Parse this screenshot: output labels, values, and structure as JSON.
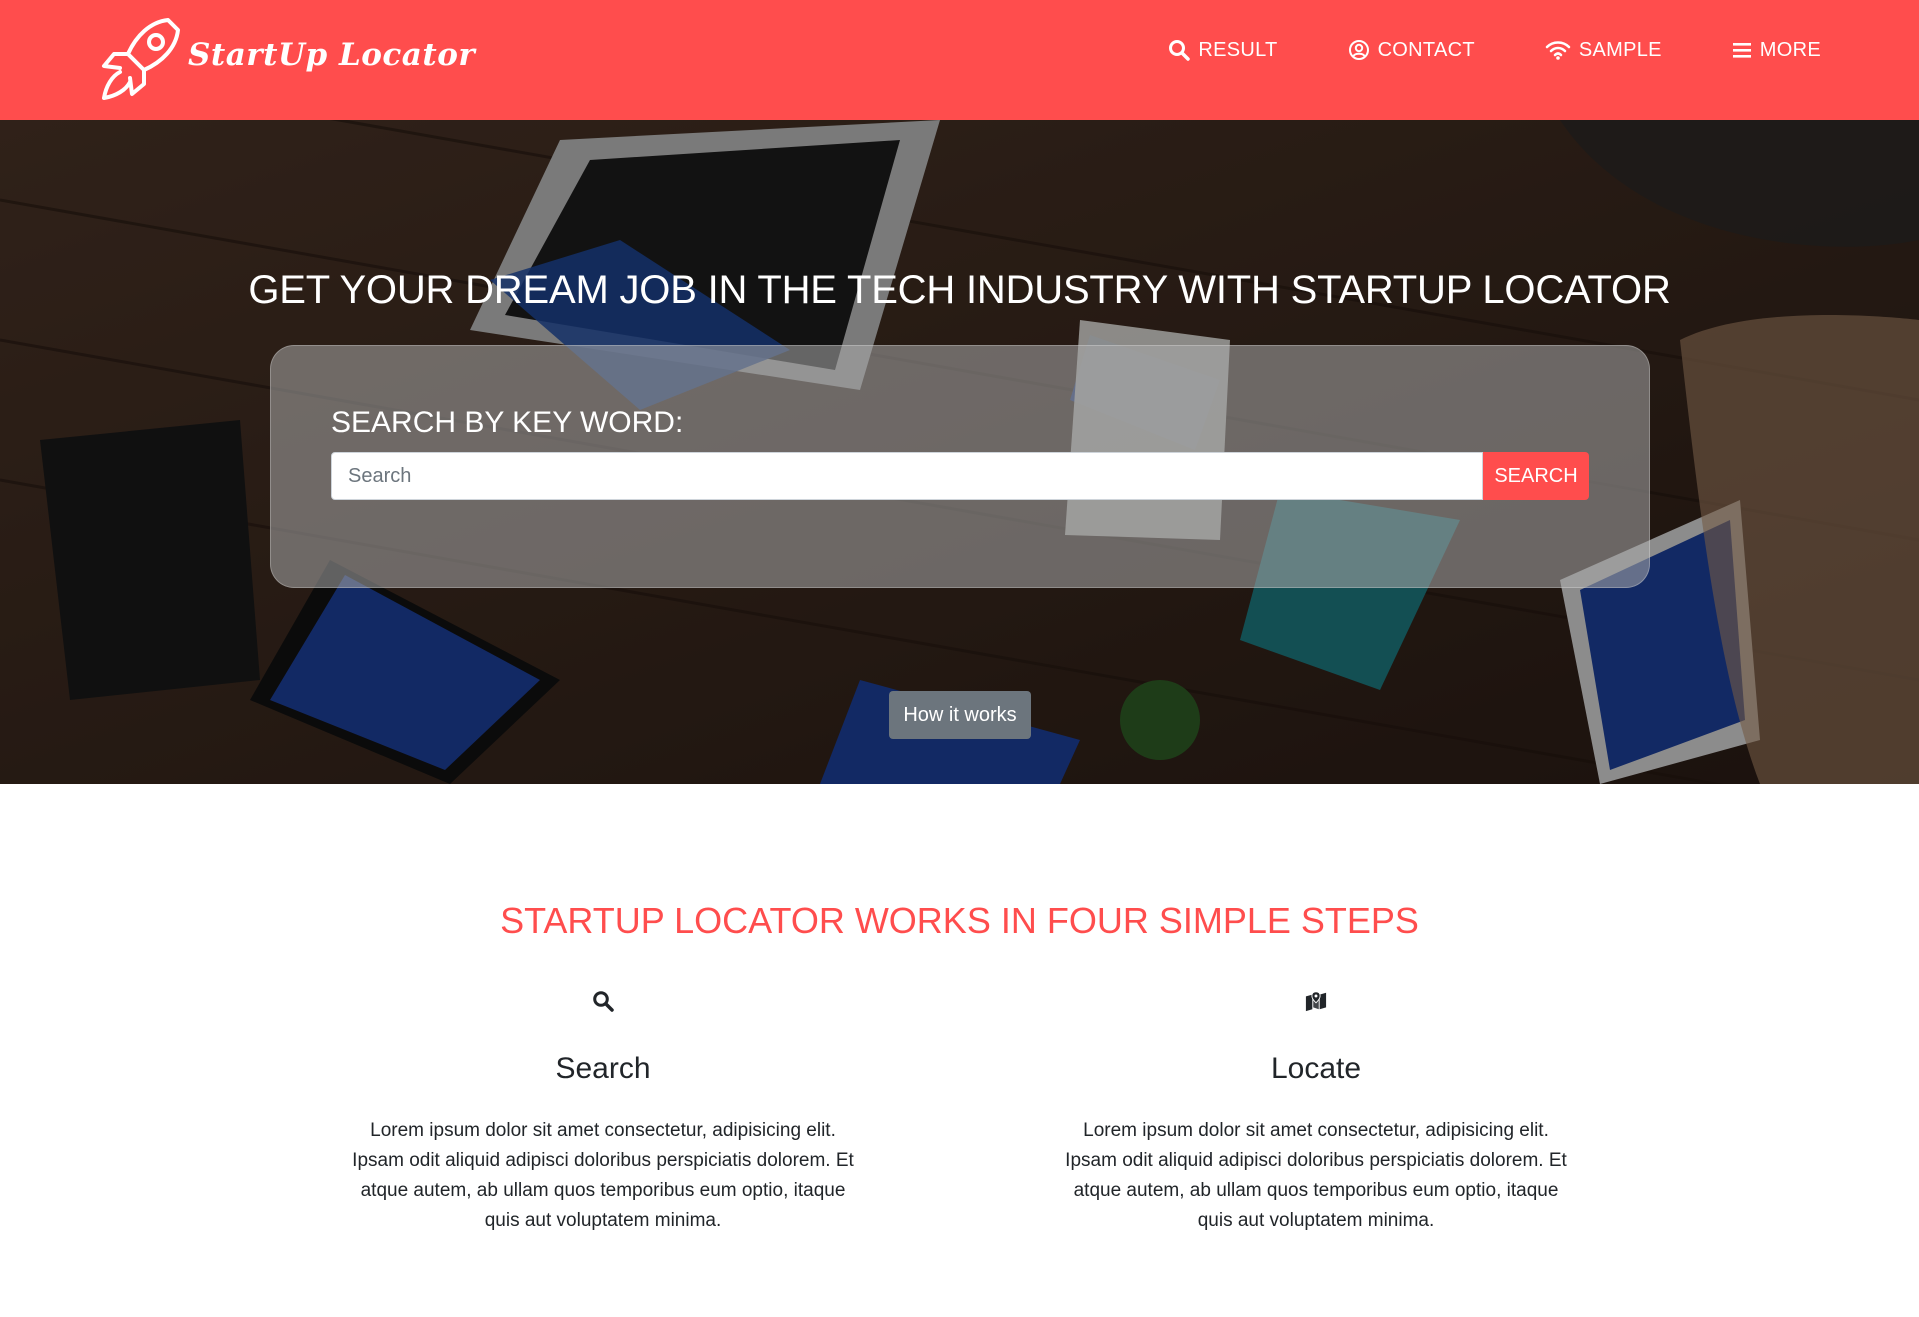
{
  "brand": {
    "name": "StartUp Locator"
  },
  "nav": [
    {
      "label": "RESULT",
      "icon": "search-icon"
    },
    {
      "label": "CONTACT",
      "icon": "user-circle-icon"
    },
    {
      "label": "SAMPLE",
      "icon": "wifi-icon"
    },
    {
      "label": "MORE",
      "icon": "menu-icon"
    }
  ],
  "hero": {
    "title": "GET YOUR DREAM JOB IN THE TECH INDUSTRY WITH STARTUP LOCATOR",
    "search_label": "SEARCH BY KEY WORD:",
    "search_placeholder": "Search",
    "search_button": "SEARCH",
    "how_button": "How it works"
  },
  "steps": {
    "title": "STARTUP LOCATOR WORKS IN FOUR SIMPLE STEPS",
    "items": [
      {
        "name": "Search",
        "icon": "search-icon",
        "text": "Lorem ipsum dolor sit amet consectetur, adipisicing elit. Ipsam odit aliquid adipisci doloribus perspiciatis dolorem. Et atque autem, ab ullam quos temporibus eum optio, itaque quis aut voluptatem minima."
      },
      {
        "name": "Locate",
        "icon": "map-marker-icon",
        "text": "Lorem ipsum dolor sit amet consectetur, adipisicing elit. Ipsam odit aliquid adipisci doloribus perspiciatis dolorem. Et atque autem, ab ullam quos temporibus eum optio, itaque quis aut voluptatem minima."
      }
    ]
  },
  "colors": {
    "brand": "#ff4d4d",
    "button_secondary": "#6c757d"
  }
}
